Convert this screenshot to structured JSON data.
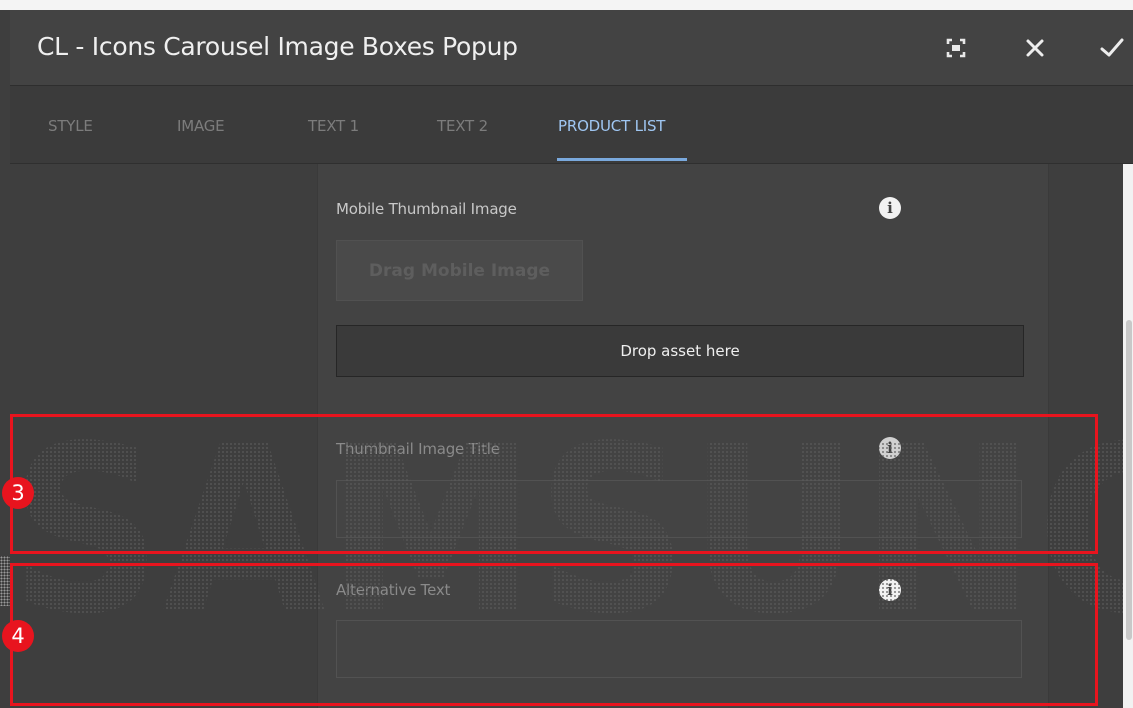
{
  "dialog": {
    "title": "CL - Icons Carousel Image Boxes Popup",
    "buttons": {
      "fullscreen_icon": "fullscreen-icon",
      "close_icon": "close-icon",
      "done_icon": "checkmark-icon"
    }
  },
  "tabs": [
    {
      "label": "STYLE",
      "active": false
    },
    {
      "label": "IMAGE",
      "active": false
    },
    {
      "label": "TEXT 1",
      "active": false
    },
    {
      "label": "TEXT 2",
      "active": false
    },
    {
      "label": "PRODUCT LIST",
      "active": true
    }
  ],
  "form": {
    "mobile_thumbnail": {
      "label": "Mobile Thumbnail Image",
      "drag_button": "Drag Mobile Image",
      "drop_zone": "Drop asset here"
    },
    "thumbnail_title": {
      "label": "Thumbnail Image Title",
      "value": ""
    },
    "alternative_text": {
      "label": "Alternative Text",
      "value": ""
    }
  },
  "annotations": [
    {
      "number": "3"
    },
    {
      "number": "4"
    }
  ],
  "watermark": {
    "text": "SAMSUNG"
  },
  "colors": {
    "accent": "#7aa9dd",
    "highlight": "#e8141e",
    "header_bg": "#434343"
  }
}
